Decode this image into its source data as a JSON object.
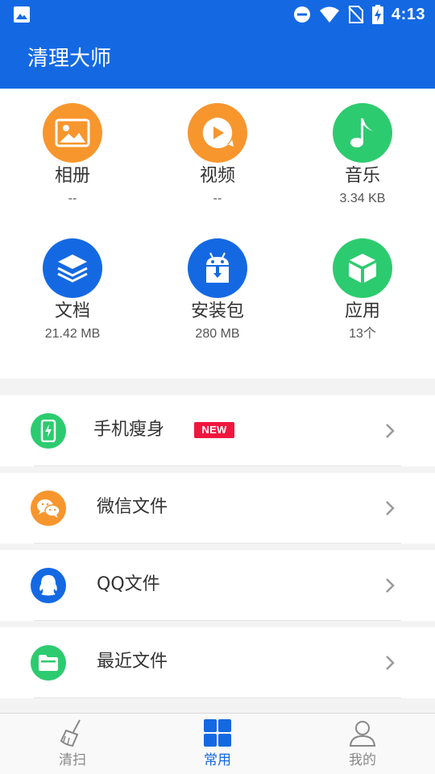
{
  "status_bar": {
    "time": "4:13"
  },
  "header": {
    "title": "清理大师"
  },
  "categories": [
    {
      "label": "相册",
      "sub": "--",
      "icon": "image-icon",
      "color": "#f7962d"
    },
    {
      "label": "视频",
      "sub": "--",
      "icon": "video-play-icon",
      "color": "#f7962d"
    },
    {
      "label": "音乐",
      "sub": "3.34 KB",
      "icon": "music-note-icon",
      "color": "#2dcb6f"
    },
    {
      "label": "文档",
      "sub": "21.42 MB",
      "icon": "layers-icon",
      "color": "#1469e3"
    },
    {
      "label": "安装包",
      "sub": "280 MB",
      "icon": "android-package-icon",
      "color": "#1469e3"
    },
    {
      "label": "应用",
      "sub": "13个",
      "icon": "cube-icon",
      "color": "#2dcb6f"
    }
  ],
  "list": [
    {
      "label": "手机瘦身",
      "badge": "NEW",
      "icon": "phone-slim-icon",
      "color": "#2dcb6f"
    },
    {
      "label": "微信文件",
      "icon": "wechat-icon",
      "color": "#f7962d"
    },
    {
      "label": "QQ文件",
      "icon": "qq-icon",
      "color": "#1469e3"
    },
    {
      "label": "最近文件",
      "icon": "folder-icon",
      "color": "#2dcb6f"
    }
  ],
  "bottom_nav": [
    {
      "label": "清扫",
      "icon": "broom-icon",
      "active": false
    },
    {
      "label": "常用",
      "icon": "grid-icon",
      "active": true
    },
    {
      "label": "我的",
      "icon": "user-icon",
      "active": false
    }
  ],
  "colors": {
    "primary": "#1469e3",
    "orange": "#f7962d",
    "green": "#2dcb6f",
    "badge": "#f0163e"
  }
}
